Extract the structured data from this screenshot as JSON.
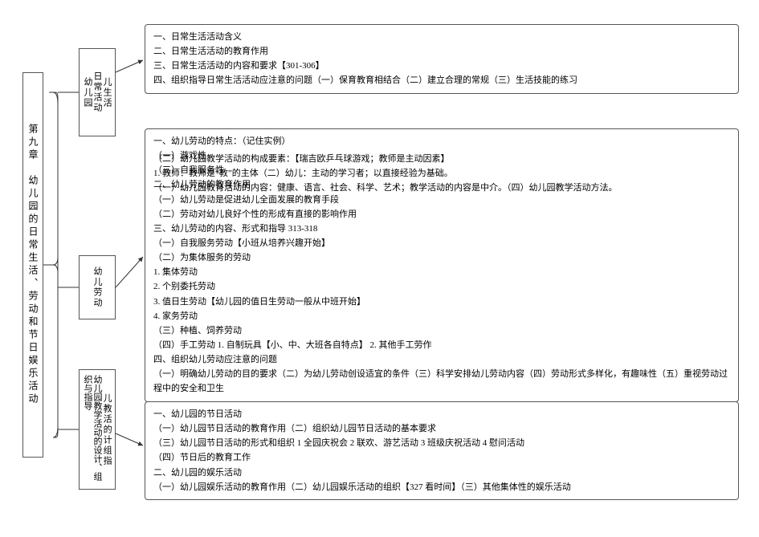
{
  "root": "第九章　幼儿园的日常生活、劳动和节日娱乐活动",
  "level2": {
    "a": {
      "col1": "幼儿园",
      "col2": "日常活动",
      "col3": "儿生活"
    },
    "b": {
      "col1": "幼儿劳动"
    },
    "c": {
      "col1": "幼儿园教学活动的设计、组织与指导",
      "col2": "儿教活的计组指"
    }
  },
  "box1": {
    "l1": "一、日常生活活动含义",
    "l2": "二、日常生活活动的教育作用",
    "l3": "三、日常生活活动的内容和要求【301-306】",
    "l4": "四、组织指导日常生活活动应注意的问题（一）保育教育相结合（二）建立合理的常规（三）生活技能的练习"
  },
  "box2": {
    "l1": "一、幼儿劳动的特点：（记住实例）",
    "l2": "（一）游戏性",
    "l2b": "（二）幼儿园教学活动的构成要素：【瑞吉欧乒乓球游戏；教师是主动因素】",
    "l3": "（三）自我服务性",
    "l3b": "1. 教师：教师是“教”的主体（二）幼儿：主动的学习者；以直接经验为基础。",
    "l4": "二、幼儿劳动的教育作用",
    "l4b": "（一）幼儿园教育活动的内容：健康、语言、社会、科学、艺术；教学活动的内容是中介。（四）幼儿园教学活动方法。",
    "l5": "（一）幼儿劳动是促进幼儿全面发展的教育手段",
    "l6": "（二）劳动对幼儿良好个性的形成有直接的影响作用",
    "l7": "三、幼儿劳动的内容、形式和指导 313-318",
    "l8": "（一）自我服务劳动【小班从培养兴趣开始】",
    "l9": "（二）为集体服务的劳动",
    "l10": "1. 集体劳动",
    "l11": "2. 个别委托劳动",
    "l12": "3. 值日生劳动【幼儿园的值日生劳动一般从中班开始】",
    "l13": "4. 家务劳动",
    "l14": "（三）种植、饲养劳动",
    "l15": "（四）手工劳动 1. 自制玩具【小、中、大班各自特点】 2. 其他手工劳作",
    "l16": "四、组织幼儿劳动应注意的问题",
    "l17": "（一）明确幼儿劳动的目的要求（二）为幼儿劳动创设适宜的条件（三）科学安排幼儿劳动内容（四）劳动形式多样化，有趣味性（五）重视劳动过程中的安全和卫生"
  },
  "box3": {
    "l1": "一、幼儿园的节日活动",
    "l2": "（一）幼儿园节日活动的教育作用（二）组织幼儿园节日活动的基本要求",
    "l3": "（三）幼儿园节日活动的形式和组织 1 全园庆祝会 2 联欢、游艺活动 3 班级庆祝活动 4 慰问活动",
    "l4": "（四）节日后的教育工作",
    "l5": "二、幼儿园的娱乐活动",
    "l6": "（一）幼儿园娱乐活动的教育作用（二）幼儿园娱乐活动的组织【327 看时间】（三）其他集体性的娱乐活动"
  }
}
